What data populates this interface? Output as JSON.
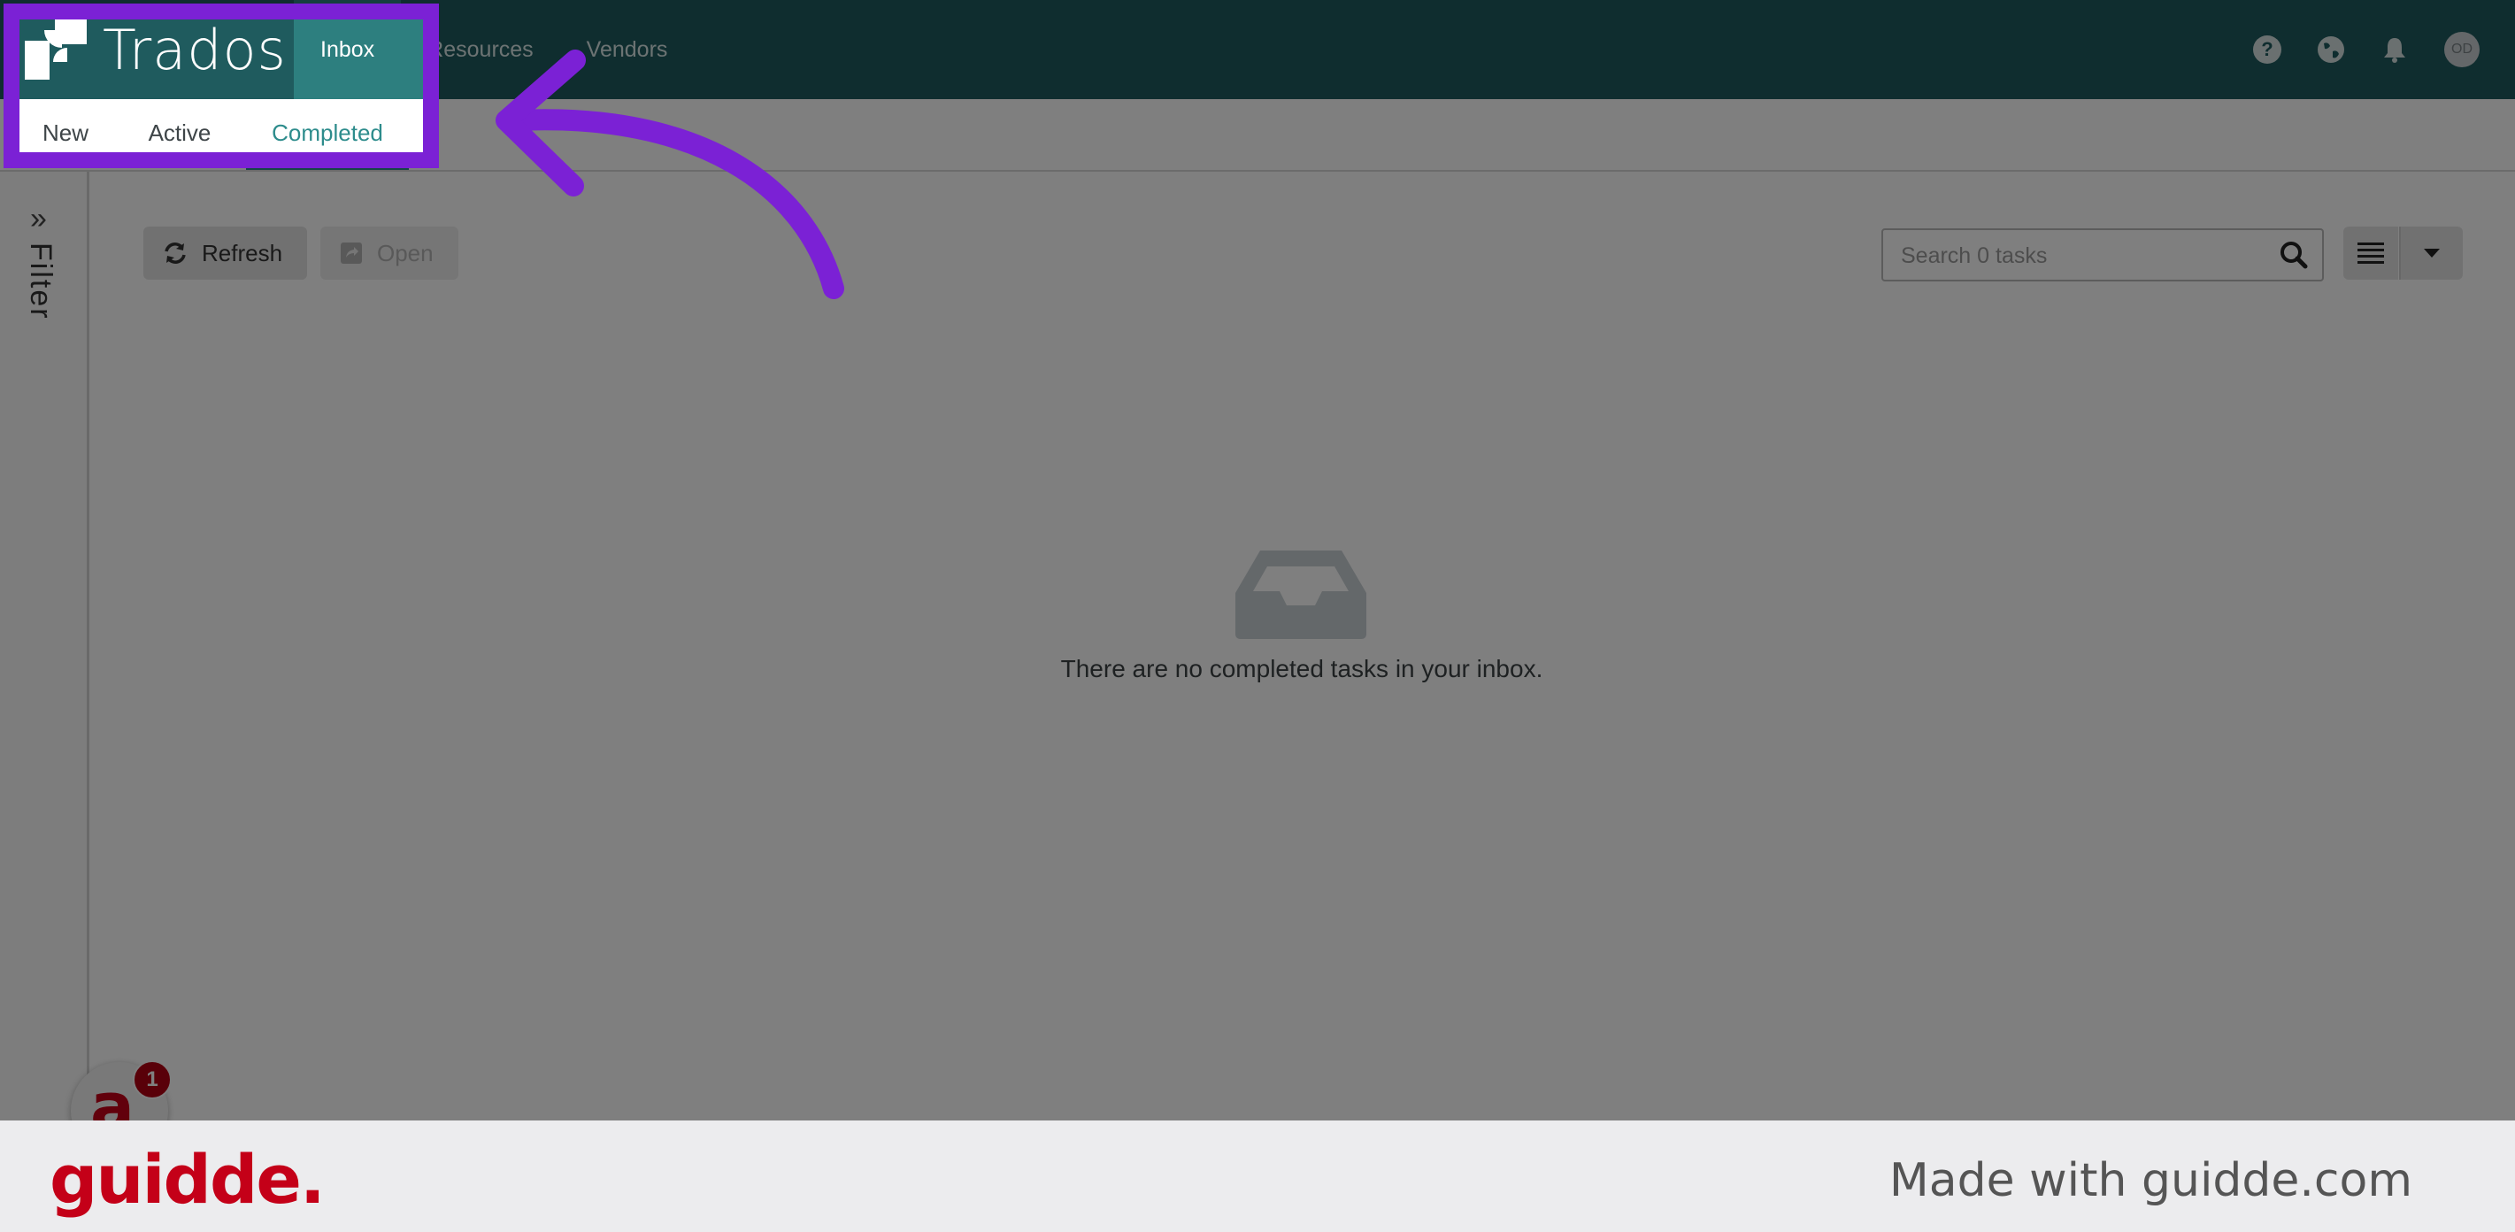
{
  "app": {
    "brand": "Trados"
  },
  "nav": {
    "items": [
      {
        "label": "Inbox"
      },
      {
        "label": "Resources"
      },
      {
        "label": "Vendors"
      }
    ]
  },
  "header": {
    "avatar_initials": "OD",
    "help_glyph": "?"
  },
  "subtabs": [
    {
      "label": "New"
    },
    {
      "label": "Active"
    },
    {
      "label": "Completed"
    }
  ],
  "filter": {
    "label": "Filter",
    "expand_glyph": "»"
  },
  "toolbar": {
    "refresh_label": "Refresh",
    "open_label": "Open"
  },
  "search": {
    "placeholder": "Search 0 tasks"
  },
  "empty_state": {
    "message": "There are no completed tasks in your inbox."
  },
  "chat_widget": {
    "letter": "a",
    "badge_count": "1"
  },
  "footer": {
    "logo_text": "guidde.",
    "tagline": "Made with guidde.com"
  },
  "colors": {
    "topbar": "#1f5b5e",
    "accent": "#2d8c8c",
    "highlight": "#7b21d5",
    "brand_red": "#c40018"
  }
}
